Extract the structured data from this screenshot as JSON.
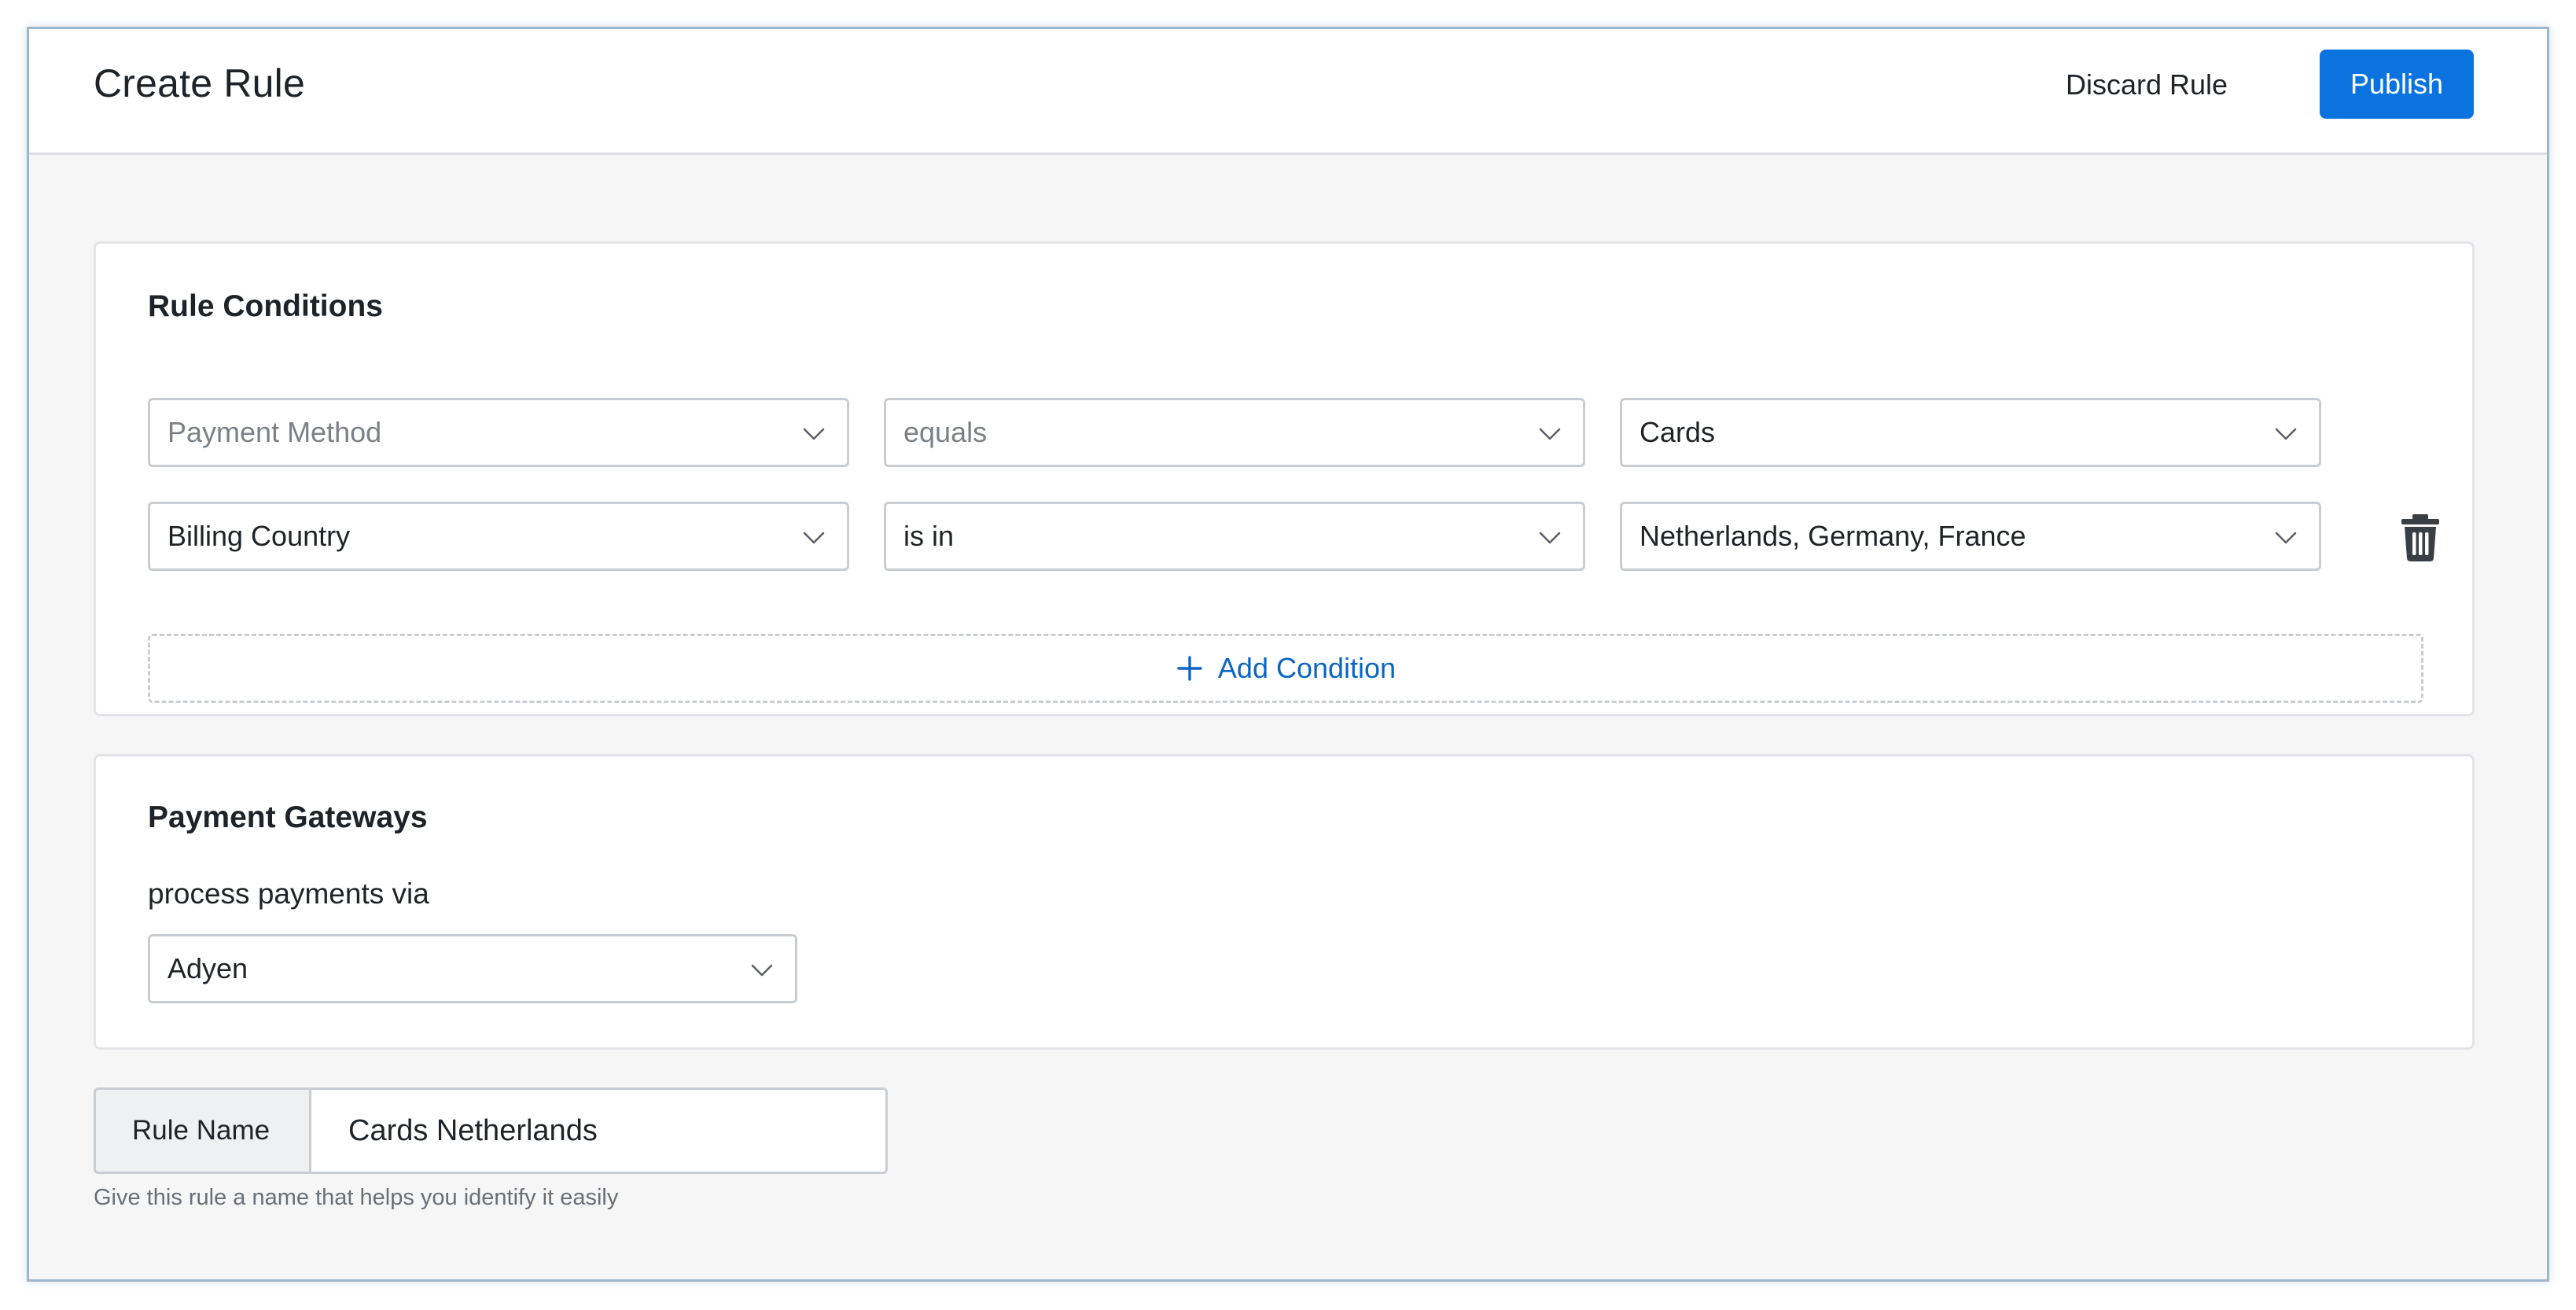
{
  "header": {
    "title": "Create Rule",
    "discard_label": "Discard Rule",
    "publish_label": "Publish"
  },
  "conditions": {
    "title": "Rule Conditions",
    "rows": [
      {
        "field": "Payment Method",
        "operator": "equals",
        "value": "Cards",
        "deletable": false
      },
      {
        "field": "Billing Country",
        "operator": "is in",
        "value": "Netherlands, Germany, France",
        "deletable": true
      }
    ],
    "add_label": "Add Condition"
  },
  "gateways": {
    "title": "Payment Gateways",
    "via_label": "process payments via",
    "selected": "Adyen"
  },
  "rule_name": {
    "label": "Rule Name",
    "value": "Cards Netherlands",
    "help": "Give this rule a name that helps you identify it easily"
  },
  "icons": {
    "dropdown": "chevron-down-icon",
    "delete": "trash-icon",
    "add": "plus-icon"
  },
  "colors": {
    "primary": "#0b73e0",
    "link": "#0b66c3",
    "accent": "#f5d547"
  }
}
